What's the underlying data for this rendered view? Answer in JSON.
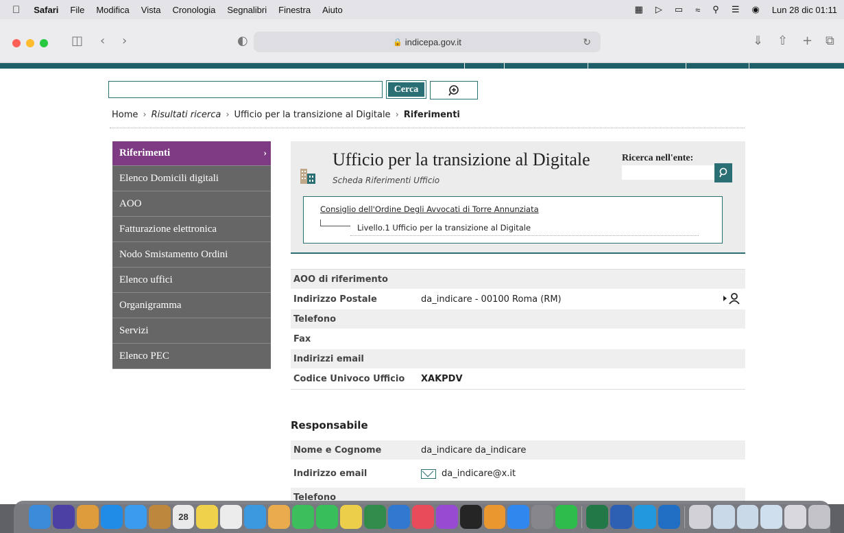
{
  "menubar": {
    "app": "Safari",
    "items": [
      "File",
      "Modifica",
      "Vista",
      "Cronologia",
      "Segnalibri",
      "Finestra",
      "Aiuto"
    ],
    "clock": "Lun 28 dic  01:11"
  },
  "browser": {
    "url": "indicepa.gov.it"
  },
  "search": {
    "button_label": "Cerca",
    "value": ""
  },
  "breadcrumb": {
    "home": "Home",
    "results": "Risultati ricerca",
    "office": "Ufficio per la transizione al Digitale",
    "current": "Riferimenti",
    "sep": "›"
  },
  "sidebar": {
    "items": [
      {
        "label": "Riferimenti",
        "active": true
      },
      {
        "label": "Elenco Domicili digitali"
      },
      {
        "label": "AOO"
      },
      {
        "label": "Fatturazione elettronica"
      },
      {
        "label": "Nodo Smistamento Ordini"
      },
      {
        "label": "Elenco uffici"
      },
      {
        "label": "Organigramma"
      },
      {
        "label": "Servizi"
      },
      {
        "label": "Elenco PEC"
      }
    ],
    "chevron": "›"
  },
  "header": {
    "title": "Ufficio per la transizione al Digitale",
    "subtitle": "Scheda Riferimenti Ufficio",
    "search_label": "Ricerca nell'ente:",
    "hierarchy_parent": "Consiglio dell'Ordine Degli Avvocati di Torre Annunziata",
    "hierarchy_level": "Livello.1 Ufficio per la transizione al Digitale"
  },
  "details": [
    {
      "label": "AOO di riferimento",
      "value": ""
    },
    {
      "label": "Indirizzo Postale",
      "value": "da_indicare - 00100 Roma (RM)"
    },
    {
      "label": "Telefono",
      "value": ""
    },
    {
      "label": "Fax",
      "value": ""
    },
    {
      "label": "Indirizzi email",
      "value": ""
    },
    {
      "label": "Codice Univoco Ufficio",
      "value": "XAKPDV"
    }
  ],
  "responsabile": {
    "title": "Responsabile",
    "rows": [
      {
        "label": "Nome e Cognome",
        "value": "da_indicare da_indicare"
      },
      {
        "label": "Indirizzo email",
        "value": "da_indicare@x.it"
      },
      {
        "label": "Telefono",
        "value": ""
      }
    ]
  },
  "colors": {
    "teal": "#2a6f73",
    "purple": "#7e3b83",
    "sidebar_gray": "#666666"
  }
}
